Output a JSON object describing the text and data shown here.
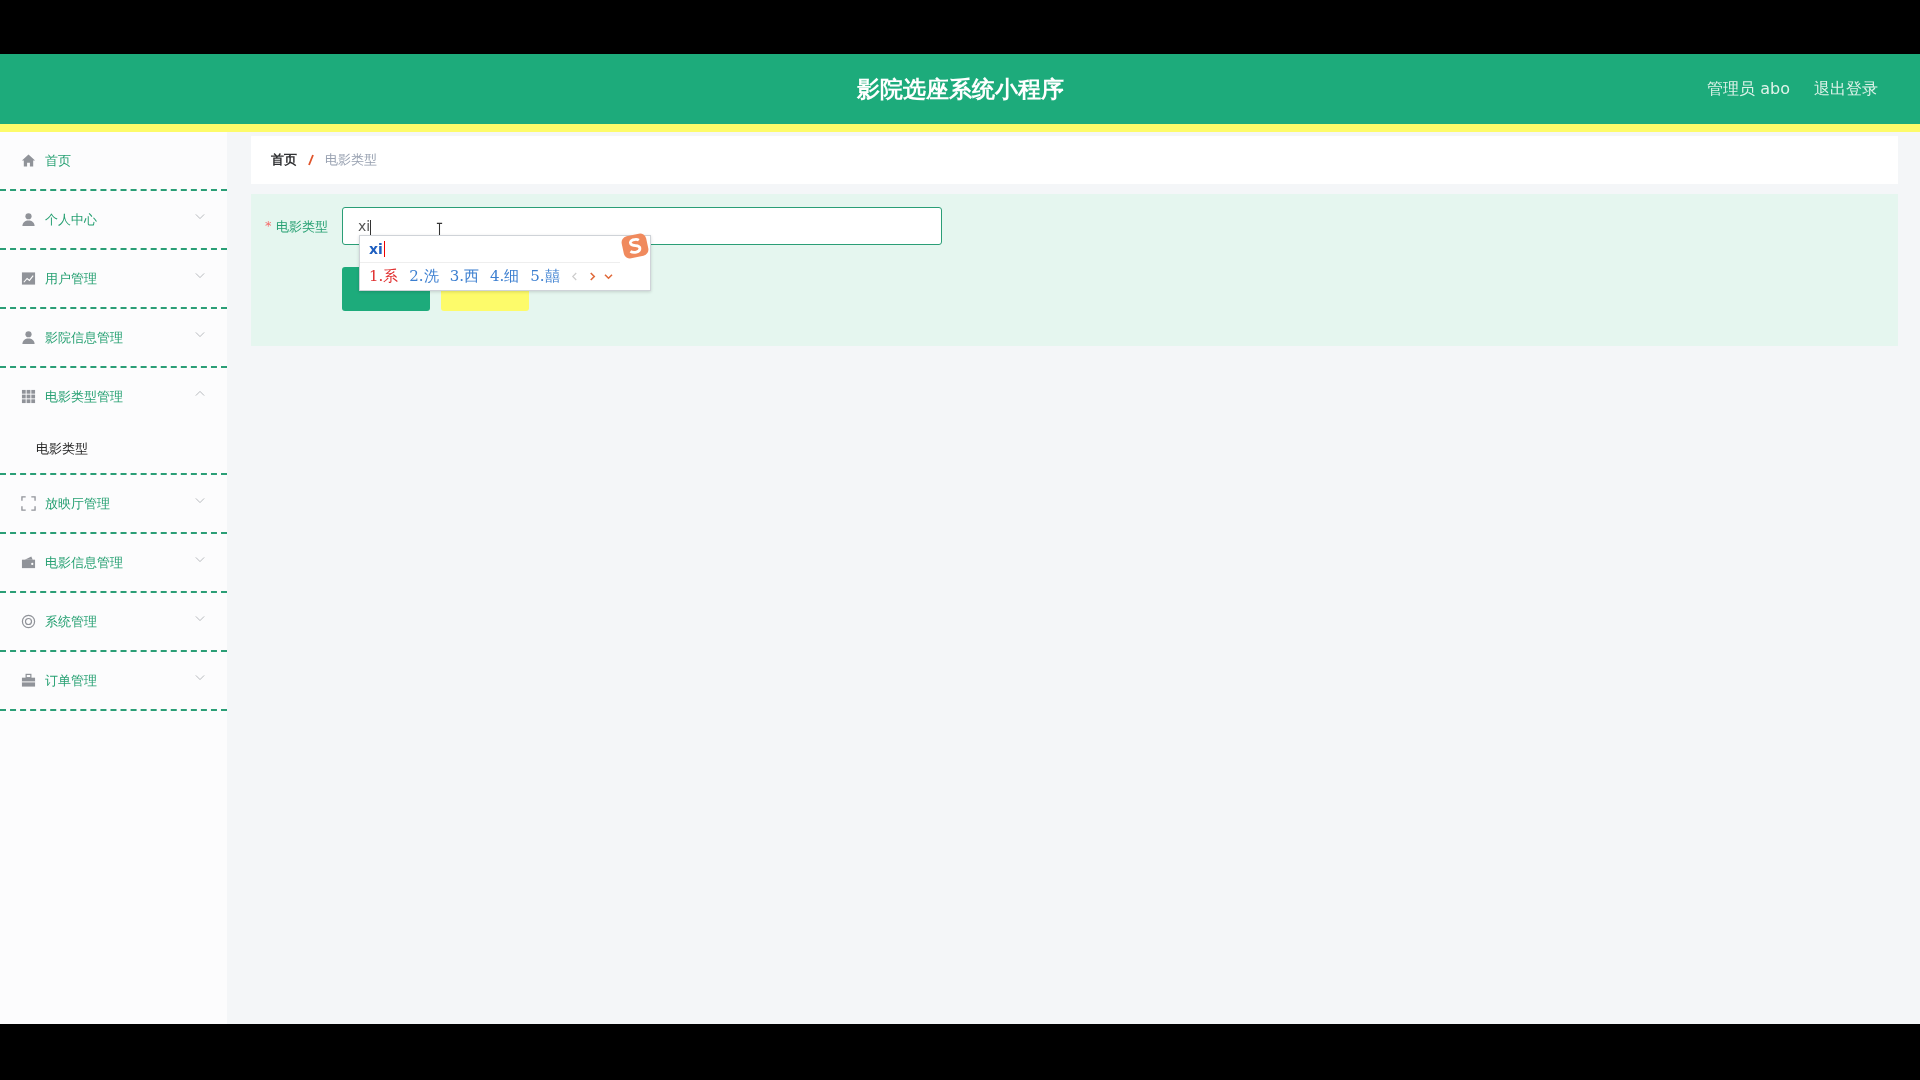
{
  "header": {
    "title": "影院选座系统小程序",
    "user": "管理员 abo",
    "logout": "退出登录"
  },
  "sidebar": {
    "items": [
      {
        "label": "首页"
      },
      {
        "label": "个人中心",
        "expanded": false
      },
      {
        "label": "用户管理",
        "expanded": false
      },
      {
        "label": "影院信息管理",
        "expanded": false
      },
      {
        "label": "电影类型管理",
        "expanded": true,
        "children": [
          {
            "label": "电影类型"
          }
        ]
      },
      {
        "label": "放映厅管理",
        "expanded": false
      },
      {
        "label": "电影信息管理",
        "expanded": false
      },
      {
        "label": "系统管理",
        "expanded": false
      },
      {
        "label": "订单管理",
        "expanded": false
      }
    ]
  },
  "breadcrumb": [
    {
      "label": "首页"
    },
    {
      "label": "电影类型"
    }
  ],
  "form": {
    "required_mark": "*",
    "label": "电影类型",
    "value": "xi",
    "buttons": [
      {
        "kind": "primary"
      },
      {
        "kind": "cancel"
      }
    ]
  },
  "ime": {
    "composition": "xi",
    "candidates": [
      {
        "label": "1.系",
        "selected": true
      },
      {
        "label": "2.洗",
        "selected": false
      },
      {
        "label": "3.西",
        "selected": false
      },
      {
        "label": "4.细",
        "selected": false
      },
      {
        "label": "5.囍",
        "selected": false
      }
    ]
  }
}
